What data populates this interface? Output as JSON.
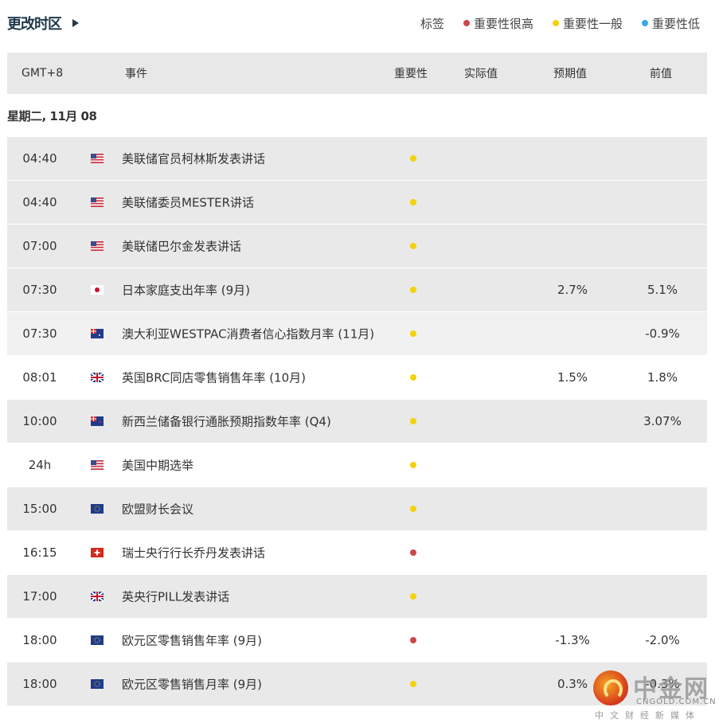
{
  "header": {
    "timezone_label": "更改时区",
    "legend_label": "标签",
    "legend": [
      {
        "label": "重要性很高",
        "color": "#c9474d"
      },
      {
        "label": "重要性一般",
        "color": "#f5d10a"
      },
      {
        "label": "重要性低",
        "color": "#3aa6e8"
      }
    ]
  },
  "table": {
    "columns": {
      "time": "GMT+8",
      "event": "事件",
      "importance": "重要性",
      "actual": "实际值",
      "forecast": "预期值",
      "previous": "前值"
    },
    "date": "星期二, 11月 08",
    "rows": [
      {
        "time": "04:40",
        "country": "us",
        "event": "美联储官员柯林斯发表讲话",
        "importance": "medium",
        "actual": "",
        "forecast": "",
        "previous": ""
      },
      {
        "time": "04:40",
        "country": "us",
        "event": "美联储委员MESTER讲话",
        "importance": "medium",
        "actual": "",
        "forecast": "",
        "previous": ""
      },
      {
        "time": "07:00",
        "country": "us",
        "event": "美联储巴尔金发表讲话",
        "importance": "medium",
        "actual": "",
        "forecast": "",
        "previous": ""
      },
      {
        "time": "07:30",
        "country": "jp",
        "event": "日本家庭支出年率 (9月)",
        "importance": "medium",
        "actual": "",
        "forecast": "2.7%",
        "previous": "5.1%"
      },
      {
        "time": "07:30",
        "country": "au",
        "event": "澳大利亚WESTPAC消费者信心指数月率 (11月)",
        "importance": "medium",
        "actual": "",
        "forecast": "",
        "previous": "-0.9%"
      },
      {
        "time": "08:01",
        "country": "gb",
        "event": "英国BRC同店零售销售年率 (10月)",
        "importance": "medium",
        "actual": "",
        "forecast": "1.5%",
        "previous": "1.8%"
      },
      {
        "time": "10:00",
        "country": "nz",
        "event": "新西兰储备银行通胀预期指数年率 (Q4)",
        "importance": "medium",
        "actual": "",
        "forecast": "",
        "previous": "3.07%"
      },
      {
        "time": "24h",
        "country": "us",
        "event": "美国中期选举",
        "importance": "medium",
        "actual": "",
        "forecast": "",
        "previous": ""
      },
      {
        "time": "15:00",
        "country": "eu",
        "event": "欧盟财长会议",
        "importance": "medium",
        "actual": "",
        "forecast": "",
        "previous": ""
      },
      {
        "time": "16:15",
        "country": "ch",
        "event": "瑞士央行行长乔丹发表讲话",
        "importance": "high",
        "actual": "",
        "forecast": "",
        "previous": ""
      },
      {
        "time": "17:00",
        "country": "gb",
        "event": "英央行PILL发表讲话",
        "importance": "medium",
        "actual": "",
        "forecast": "",
        "previous": ""
      },
      {
        "time": "18:00",
        "country": "eu",
        "event": "欧元区零售销售年率 (9月)",
        "importance": "high",
        "actual": "",
        "forecast": "-1.3%",
        "previous": "-2.0%"
      },
      {
        "time": "18:00",
        "country": "eu",
        "event": "欧元区零售销售月率 (9月)",
        "importance": "medium",
        "actual": "",
        "forecast": "0.3%",
        "previous": "-0.3%"
      }
    ]
  },
  "watermark": {
    "name": "中金网",
    "domain": "CNGOLD.COM.CN",
    "tagline": "中文财经新媒体"
  }
}
